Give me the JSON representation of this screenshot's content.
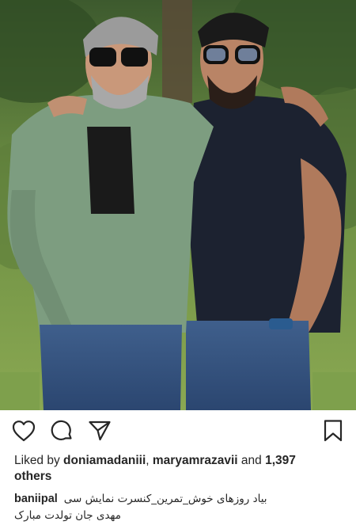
{
  "photo": {
    "description_icon": "photo"
  },
  "actions": {
    "like_icon": "heart-outline-icon",
    "comment_icon": "comment-bubble-icon",
    "share_icon": "paper-plane-icon",
    "save_icon": "bookmark-outline-icon"
  },
  "likes": {
    "prefix": "Liked by ",
    "user1": "doniamadaniii",
    "separator": ", ",
    "user2": "maryamrazavii",
    "and_text": " and ",
    "count": "1,397",
    "suffix": "others"
  },
  "caption": {
    "username": "banii‌pal",
    "line1": "بیاد روزهای خوش_تمرین_کنسرت نمایش سی",
    "line2": "مهدی جان تولدت مبارک"
  },
  "colors": {
    "text": "#262626",
    "background": "#ffffff"
  }
}
